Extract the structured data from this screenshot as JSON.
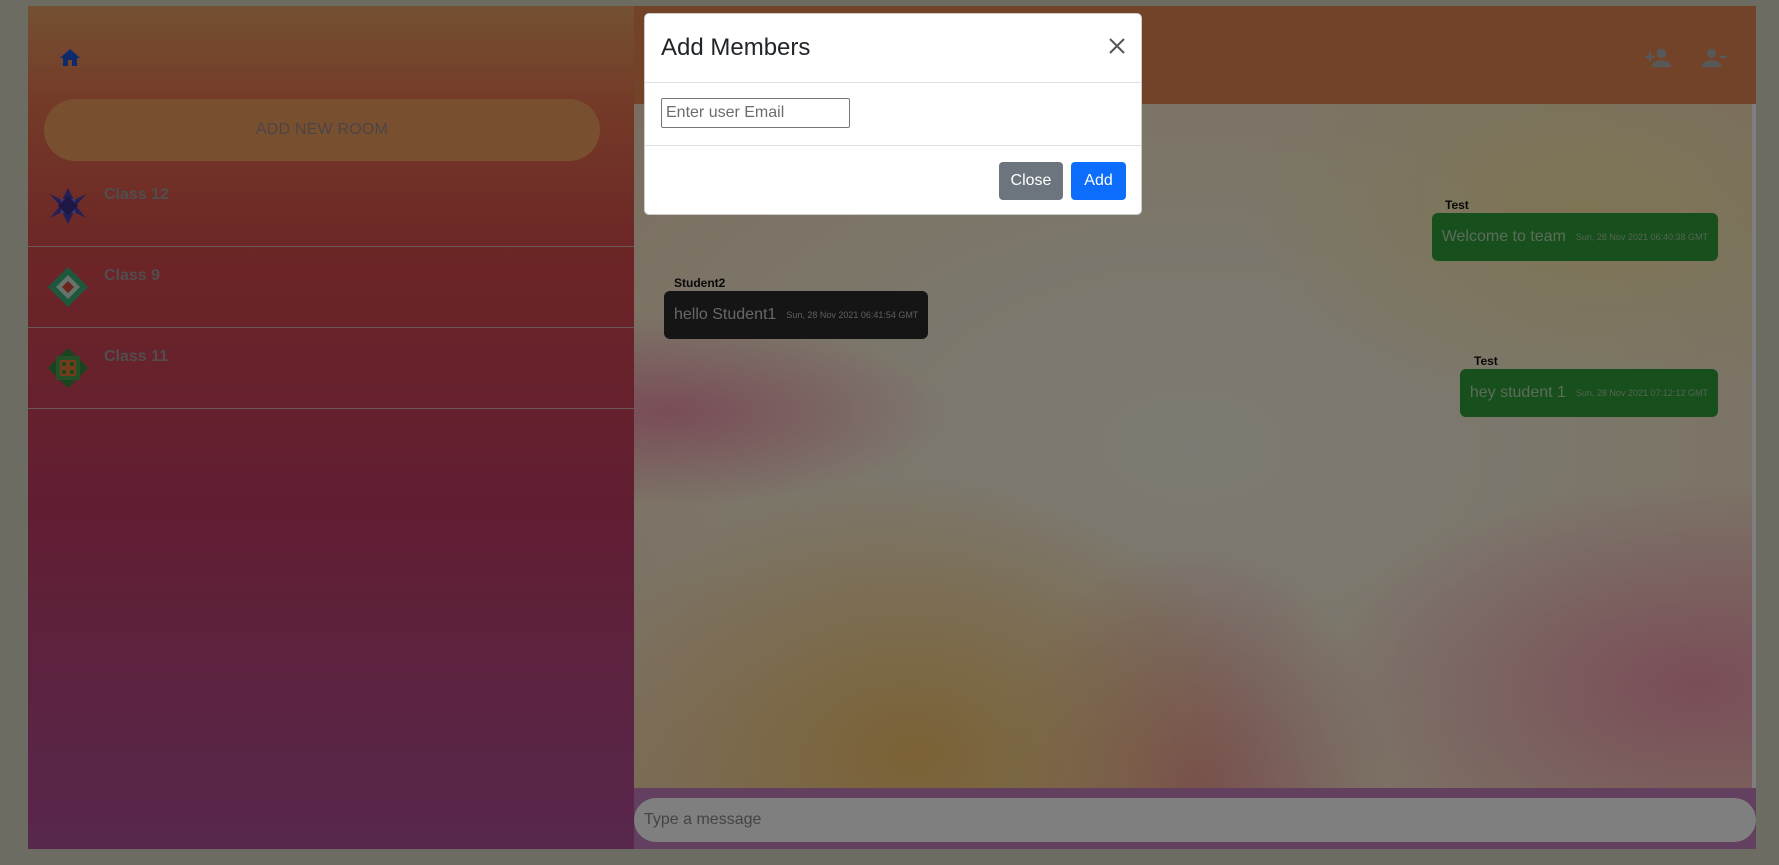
{
  "sidebar": {
    "home_icon": "home-icon",
    "add_room_label": "ADD NEW ROOM",
    "rooms": [
      {
        "name": "Class 12",
        "avatar": "geometric-avatar-purple"
      },
      {
        "name": "Class 9",
        "avatar": "geometric-avatar-green"
      },
      {
        "name": "Class 11",
        "avatar": "geometric-avatar-orange"
      }
    ]
  },
  "header": {
    "add_member_icon": "person-add-icon",
    "remove_member_icon": "person-remove-icon"
  },
  "messages": [
    {
      "sender": "Test",
      "text": "Welcome to team",
      "time": "Sun, 28 Nov 2021 06:40:38 GMT",
      "side": "right"
    },
    {
      "sender": "Student2",
      "text": "hello Student1",
      "time": "Sun, 28 Nov 2021 06:41:54 GMT",
      "side": "left"
    },
    {
      "sender": "Test",
      "text": "hey student 1",
      "time": "Sun, 28 Nov 2021 07:12:12 GMT",
      "side": "right"
    }
  ],
  "composer": {
    "placeholder": "Type a message"
  },
  "modal": {
    "title": "Add Members",
    "email_placeholder": "Enter user Email",
    "close_label": "Close",
    "add_label": "Add"
  },
  "colors": {
    "sent_bubble": "#2f9e3a",
    "received_bubble": "#2b2b2b",
    "primary": "#0d6efd",
    "secondary": "#6c757d"
  }
}
